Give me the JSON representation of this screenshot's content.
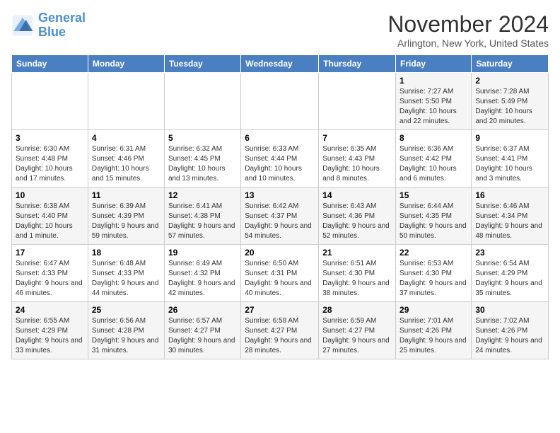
{
  "logo": {
    "line1": "General",
    "line2": "Blue"
  },
  "title": "November 2024",
  "subtitle": "Arlington, New York, United States",
  "days_of_week": [
    "Sunday",
    "Monday",
    "Tuesday",
    "Wednesday",
    "Thursday",
    "Friday",
    "Saturday"
  ],
  "weeks": [
    [
      {
        "day": "",
        "info": ""
      },
      {
        "day": "",
        "info": ""
      },
      {
        "day": "",
        "info": ""
      },
      {
        "day": "",
        "info": ""
      },
      {
        "day": "",
        "info": ""
      },
      {
        "day": "1",
        "info": "Sunrise: 7:27 AM\nSunset: 5:50 PM\nDaylight: 10 hours and 22 minutes."
      },
      {
        "day": "2",
        "info": "Sunrise: 7:28 AM\nSunset: 5:49 PM\nDaylight: 10 hours and 20 minutes."
      }
    ],
    [
      {
        "day": "3",
        "info": "Sunrise: 6:30 AM\nSunset: 4:48 PM\nDaylight: 10 hours and 17 minutes."
      },
      {
        "day": "4",
        "info": "Sunrise: 6:31 AM\nSunset: 4:46 PM\nDaylight: 10 hours and 15 minutes."
      },
      {
        "day": "5",
        "info": "Sunrise: 6:32 AM\nSunset: 4:45 PM\nDaylight: 10 hours and 13 minutes."
      },
      {
        "day": "6",
        "info": "Sunrise: 6:33 AM\nSunset: 4:44 PM\nDaylight: 10 hours and 10 minutes."
      },
      {
        "day": "7",
        "info": "Sunrise: 6:35 AM\nSunset: 4:43 PM\nDaylight: 10 hours and 8 minutes."
      },
      {
        "day": "8",
        "info": "Sunrise: 6:36 AM\nSunset: 4:42 PM\nDaylight: 10 hours and 6 minutes."
      },
      {
        "day": "9",
        "info": "Sunrise: 6:37 AM\nSunset: 4:41 PM\nDaylight: 10 hours and 3 minutes."
      }
    ],
    [
      {
        "day": "10",
        "info": "Sunrise: 6:38 AM\nSunset: 4:40 PM\nDaylight: 10 hours and 1 minute."
      },
      {
        "day": "11",
        "info": "Sunrise: 6:39 AM\nSunset: 4:39 PM\nDaylight: 9 hours and 59 minutes."
      },
      {
        "day": "12",
        "info": "Sunrise: 6:41 AM\nSunset: 4:38 PM\nDaylight: 9 hours and 57 minutes."
      },
      {
        "day": "13",
        "info": "Sunrise: 6:42 AM\nSunset: 4:37 PM\nDaylight: 9 hours and 54 minutes."
      },
      {
        "day": "14",
        "info": "Sunrise: 6:43 AM\nSunset: 4:36 PM\nDaylight: 9 hours and 52 minutes."
      },
      {
        "day": "15",
        "info": "Sunrise: 6:44 AM\nSunset: 4:35 PM\nDaylight: 9 hours and 50 minutes."
      },
      {
        "day": "16",
        "info": "Sunrise: 6:46 AM\nSunset: 4:34 PM\nDaylight: 9 hours and 48 minutes."
      }
    ],
    [
      {
        "day": "17",
        "info": "Sunrise: 6:47 AM\nSunset: 4:33 PM\nDaylight: 9 hours and 46 minutes."
      },
      {
        "day": "18",
        "info": "Sunrise: 6:48 AM\nSunset: 4:33 PM\nDaylight: 9 hours and 44 minutes."
      },
      {
        "day": "19",
        "info": "Sunrise: 6:49 AM\nSunset: 4:32 PM\nDaylight: 9 hours and 42 minutes."
      },
      {
        "day": "20",
        "info": "Sunrise: 6:50 AM\nSunset: 4:31 PM\nDaylight: 9 hours and 40 minutes."
      },
      {
        "day": "21",
        "info": "Sunrise: 6:51 AM\nSunset: 4:30 PM\nDaylight: 9 hours and 38 minutes."
      },
      {
        "day": "22",
        "info": "Sunrise: 6:53 AM\nSunset: 4:30 PM\nDaylight: 9 hours and 37 minutes."
      },
      {
        "day": "23",
        "info": "Sunrise: 6:54 AM\nSunset: 4:29 PM\nDaylight: 9 hours and 35 minutes."
      }
    ],
    [
      {
        "day": "24",
        "info": "Sunrise: 6:55 AM\nSunset: 4:29 PM\nDaylight: 9 hours and 33 minutes."
      },
      {
        "day": "25",
        "info": "Sunrise: 6:56 AM\nSunset: 4:28 PM\nDaylight: 9 hours and 31 minutes."
      },
      {
        "day": "26",
        "info": "Sunrise: 6:57 AM\nSunset: 4:27 PM\nDaylight: 9 hours and 30 minutes."
      },
      {
        "day": "27",
        "info": "Sunrise: 6:58 AM\nSunset: 4:27 PM\nDaylight: 9 hours and 28 minutes."
      },
      {
        "day": "28",
        "info": "Sunrise: 6:59 AM\nSunset: 4:27 PM\nDaylight: 9 hours and 27 minutes."
      },
      {
        "day": "29",
        "info": "Sunrise: 7:01 AM\nSunset: 4:26 PM\nDaylight: 9 hours and 25 minutes."
      },
      {
        "day": "30",
        "info": "Sunrise: 7:02 AM\nSunset: 4:26 PM\nDaylight: 9 hours and 24 minutes."
      }
    ]
  ]
}
